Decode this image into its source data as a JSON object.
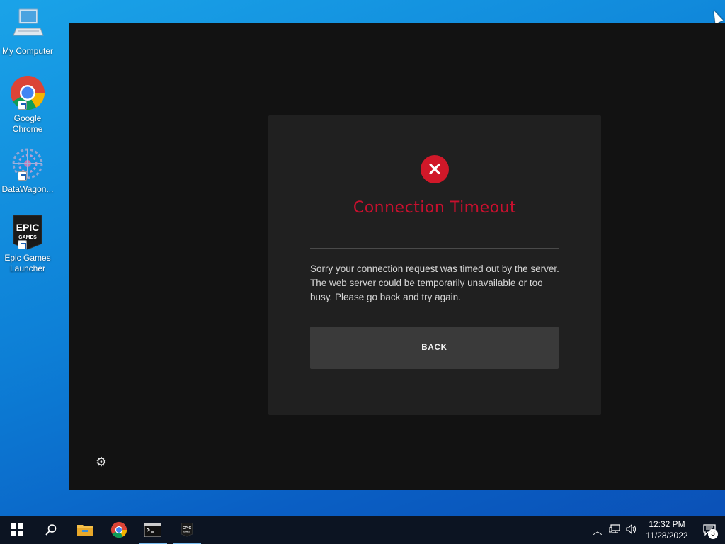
{
  "desktop": {
    "icons": [
      {
        "label": "My Computer"
      },
      {
        "label": "Google Chrome"
      },
      {
        "label": "DataWagon..."
      },
      {
        "label": "Epic Games Launcher"
      }
    ]
  },
  "dialog": {
    "title": "Connection Timeout",
    "message": "Sorry your connection request was timed out by the server. The web server could be temporarily unavailable or too busy. Please go back and try again.",
    "back_label": "BACK"
  },
  "epic_logo": {
    "line1": "EPIC",
    "line2": "GAMES"
  },
  "taskbar": {
    "time": "12:32 PM",
    "date": "11/28/2022",
    "notification_count": "3"
  },
  "colors": {
    "error_red": "#c8102e",
    "window_bg": "#121212",
    "dialog_bg": "#202020",
    "button_bg": "#3a3a3a"
  }
}
